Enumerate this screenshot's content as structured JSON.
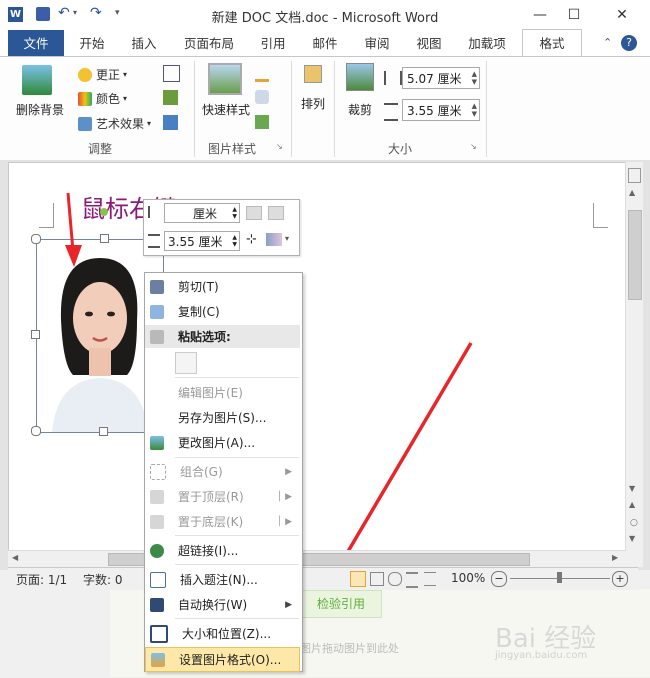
{
  "window": {
    "title": "新建 DOC 文档.doc - Microsoft Word",
    "minimize": "—",
    "maximize": "☐",
    "close": "✕",
    "app_icon": "W"
  },
  "tabs": [
    {
      "label": "文件"
    },
    {
      "label": "开始"
    },
    {
      "label": "插入"
    },
    {
      "label": "页面布局"
    },
    {
      "label": "引用"
    },
    {
      "label": "邮件"
    },
    {
      "label": "审阅"
    },
    {
      "label": "视图"
    },
    {
      "label": "加载项"
    },
    {
      "label": "格式"
    }
  ],
  "ribbon": {
    "remove_bg": "删除背景",
    "corrections": "更正",
    "color": "颜色",
    "artistic": "艺术效果",
    "adjust_group": "调整",
    "quick_styles": "快速样式",
    "picture_styles_group": "图片样式",
    "arrange": "排列",
    "crop": "裁剪",
    "height": "5.07 厘米",
    "width": "3.55 厘米",
    "size_group": "大小"
  },
  "annotation": "鼠标右键",
  "mini_toolbar": {
    "height_value": "厘米",
    "width_value": "3.55 厘米"
  },
  "context_menu": [
    {
      "label": "剪切(T)",
      "enabled": true,
      "icon": "scissors-icon"
    },
    {
      "label": "复制(C)",
      "enabled": true,
      "icon": "copy-icon"
    },
    {
      "label": "粘贴选项:",
      "enabled": true,
      "icon": "paste-icon",
      "bold": true
    },
    {
      "label": "编辑图片(E)",
      "enabled": false,
      "icon": ""
    },
    {
      "label": "另存为图片(S)...",
      "enabled": true,
      "icon": ""
    },
    {
      "label": "更改图片(A)...",
      "enabled": true,
      "icon": "change-picture-icon"
    },
    {
      "label": "组合(G)",
      "enabled": false,
      "icon": "group-icon",
      "submenu": true
    },
    {
      "label": "置于顶层(R)",
      "enabled": false,
      "icon": "bring-front-icon",
      "submenu": true
    },
    {
      "label": "置于底层(K)",
      "enabled": false,
      "icon": "send-back-icon",
      "submenu": true
    },
    {
      "label": "超链接(I)...",
      "enabled": true,
      "icon": "hyperlink-icon"
    },
    {
      "label": "插入题注(N)...",
      "enabled": true,
      "icon": "caption-icon"
    },
    {
      "label": "自动换行(W)",
      "enabled": true,
      "icon": "wrap-icon",
      "submenu": true
    },
    {
      "label": "大小和位置(Z)...",
      "enabled": true,
      "icon": "size-position-icon"
    },
    {
      "label": "设置图片格式(O)...",
      "enabled": true,
      "icon": "format-picture-icon"
    }
  ],
  "status": {
    "page": "页面: 1/1",
    "words": "字数: 0",
    "zoom": "100%"
  },
  "background_text": {
    "button": "检验引用",
    "caption": "图片拖动图片到此处",
    "watermark": "Bai 经验",
    "watermark_url": "jingyan.baidu.com"
  },
  "colors": {
    "file_tab": "#2b5797",
    "arrow": "#e8262a",
    "annotation": "#8b1a7a"
  }
}
